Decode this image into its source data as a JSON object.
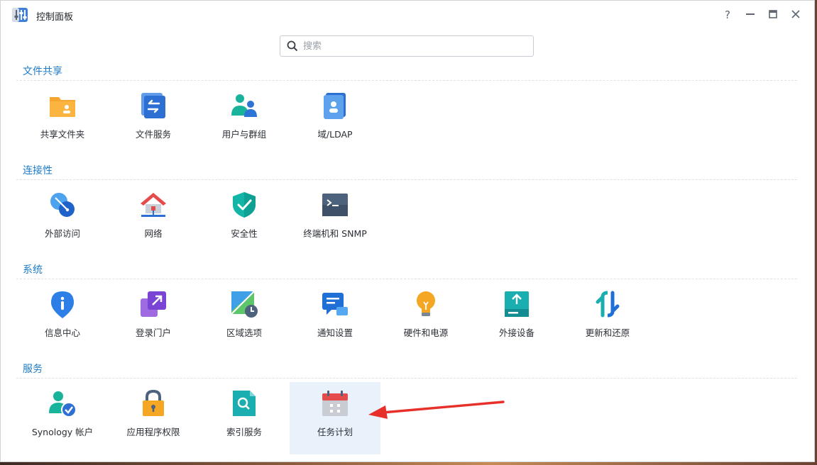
{
  "window": {
    "title": "控制面板",
    "controls": {
      "help": "?",
      "minimize": "—",
      "maximize": "▭",
      "close": "✕"
    }
  },
  "search": {
    "placeholder": "搜索",
    "value": ""
  },
  "sections": [
    {
      "title": "文件共享",
      "items": [
        "共享文件夹",
        "文件服务",
        "用户与群组",
        "域/LDAP"
      ]
    },
    {
      "title": "连接性",
      "items": [
        "外部访问",
        "网络",
        "安全性",
        "终端机和 SNMP"
      ]
    },
    {
      "title": "系统",
      "items": [
        "信息中心",
        "登录门户",
        "区域选项",
        "通知设置",
        "硬件和电源",
        "外接设备",
        "更新和还原"
      ]
    },
    {
      "title": "服务",
      "items": [
        "Synology 帐户",
        "应用程序权限",
        "索引服务",
        "任务计划"
      ]
    }
  ],
  "selected_item": "任务计划",
  "annotation": {
    "type": "red-arrow",
    "color": "#e8302a",
    "points_to": "任务计划"
  },
  "colors": {
    "accent": "#1e7bc7",
    "selected_bg": "#e9f1fb"
  }
}
